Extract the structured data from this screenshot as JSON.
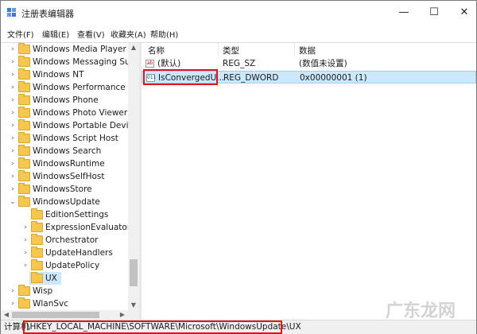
{
  "window": {
    "title": "注册表编辑器",
    "controls": {
      "minimize": "—",
      "maximize": "☐",
      "close": "✕"
    }
  },
  "menu": [
    "文件(F)",
    "编辑(E)",
    "查看(V)",
    "收藏夹(A)",
    "帮助(H)"
  ],
  "tree": {
    "items": [
      {
        "label": "Windows Media Player NS",
        "expander": "›"
      },
      {
        "label": "Windows Messaging Subs",
        "expander": "›"
      },
      {
        "label": "Windows NT",
        "expander": "›"
      },
      {
        "label": "Windows Performance To",
        "expander": "›"
      },
      {
        "label": "Windows Phone",
        "expander": "›"
      },
      {
        "label": "Windows Photo Viewer",
        "expander": "›"
      },
      {
        "label": "Windows Portable Devices",
        "expander": "›"
      },
      {
        "label": "Windows Script Host",
        "expander": "›"
      },
      {
        "label": "Windows Search",
        "expander": "›"
      },
      {
        "label": "WindowsRuntime",
        "expander": "›"
      },
      {
        "label": "WindowsSelfHost",
        "expander": "›"
      },
      {
        "label": "WindowsStore",
        "expander": "›"
      },
      {
        "label": "WindowsUpdate",
        "expander": "⌄"
      },
      {
        "label": "EditionSettings",
        "expander": ""
      },
      {
        "label": "ExpressionEvaluators",
        "expander": "›"
      },
      {
        "label": "Orchestrator",
        "expander": "›"
      },
      {
        "label": "UpdateHandlers",
        "expander": "›"
      },
      {
        "label": "UpdatePolicy",
        "expander": "›"
      },
      {
        "label": "UX",
        "expander": ""
      },
      {
        "label": "Wisp",
        "expander": "›"
      },
      {
        "label": "WlanSvc",
        "expander": "›"
      }
    ]
  },
  "list": {
    "columns": [
      "名称",
      "类型",
      "数据"
    ],
    "rows": [
      {
        "icon": "ab",
        "name": "(默认)",
        "type": "REG_SZ",
        "data": "(数值未设置)"
      },
      {
        "icon": "011",
        "name": "IsConvergedU...",
        "type": "REG_DWORD",
        "data": "0x00000001 (1)"
      }
    ]
  },
  "status": {
    "prefix": "计算机",
    "path": "\\HKEY_LOCAL_MACHINE\\SOFTWARE\\Microsoft\\WindowsUpdate\\UX"
  },
  "watermark": "广东龙网",
  "colors": {
    "highlight": "#e0151b",
    "selection": "#cce8ff",
    "folder": "#f5c74f"
  }
}
